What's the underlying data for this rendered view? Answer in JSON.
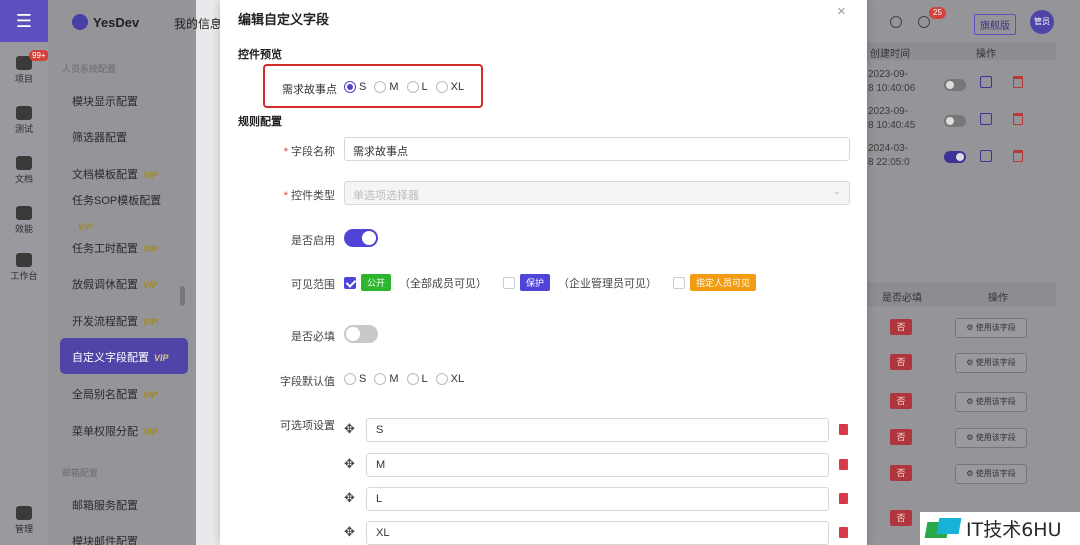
{
  "app": {
    "brand": "YesDev",
    "my_info": "我的信息"
  },
  "rail": {
    "items": [
      {
        "label": "项目",
        "icon": "cube-icon",
        "badge": "99+"
      },
      {
        "label": "测试",
        "icon": "test-icon"
      },
      {
        "label": "文档",
        "icon": "database-icon"
      },
      {
        "label": "效能",
        "icon": "chart-icon"
      },
      {
        "label": "工作台",
        "icon": "grid-icon"
      },
      {
        "label": "管理",
        "icon": "manage-icon"
      }
    ]
  },
  "sidebar": {
    "section1": "人员系统配置",
    "section2": "邮箱配置",
    "items": [
      {
        "label": "模块显示配置",
        "vip": ""
      },
      {
        "label": "筛选器配置",
        "vip": ""
      },
      {
        "label": "文档模板配置",
        "vip": "VIP"
      },
      {
        "label": "任务SOP模板配置",
        "vip": "VIP"
      },
      {
        "label": "任务工时配置",
        "vip": "VIP"
      },
      {
        "label": "放假调休配置",
        "vip": "VIP"
      },
      {
        "label": "开发流程配置",
        "vip": "VIP"
      },
      {
        "label": "全局别名配置",
        "vip": "VIP"
      },
      {
        "label": "菜单权限分配",
        "vip": "VIP"
      },
      {
        "label": "邮箱服务配置",
        "vip": ""
      },
      {
        "label": "模块邮件配置",
        "vip": ""
      }
    ],
    "active": {
      "label": "自定义字段配置",
      "vip": "VIP"
    }
  },
  "topbar": {
    "notify_badge": "25",
    "flagship": "旗舰版",
    "avatar": "管员"
  },
  "bg_table1": {
    "head": [
      "创建时间",
      "操作"
    ],
    "rows": [
      {
        "date1": "2023-09-",
        "date2": "8 10:40:06",
        "enabled": false
      },
      {
        "date1": "2023-09-",
        "date2": "8 10:40:45",
        "enabled": false
      },
      {
        "date1": "2024-03-",
        "date2": "8 22:05:0",
        "enabled": true
      }
    ]
  },
  "bg_table2": {
    "head": [
      "是否必填",
      "操作"
    ],
    "no_label": "否",
    "use_label": "使用该字段",
    "rows": 6
  },
  "modal": {
    "title": "编辑自定义字段",
    "close": "×",
    "preview_section": "控件预览",
    "preview_label": "需求故事点",
    "preview_options": [
      "S",
      "M",
      "L",
      "XL"
    ],
    "preview_selected": "S",
    "rules_section": "规则配置",
    "field_name_label": "字段名称",
    "field_name_value": "需求故事点",
    "control_type_label": "控件类型",
    "control_type_value": "单选项选择器",
    "enabled_label": "是否启用",
    "enabled": true,
    "visibility_label": "可见范围",
    "visibility": [
      {
        "tag": "公开",
        "desc": "（全部成员可见）",
        "checked": true,
        "color": "#2db52d"
      },
      {
        "tag": "保护",
        "desc": "（企业管理员可见）",
        "checked": false,
        "color": "#4f44d8"
      },
      {
        "tag": "指定人员可见",
        "desc": "",
        "checked": false,
        "color": "#f39c12"
      }
    ],
    "required_label": "是否必填",
    "required": false,
    "default_label": "字段默认值",
    "default_options": [
      "S",
      "M",
      "L",
      "XL"
    ],
    "options_label": "可选项设置",
    "options": [
      "S",
      "M",
      "L",
      "XL"
    ]
  },
  "watermark": {
    "text": "IT技术6HU"
  }
}
